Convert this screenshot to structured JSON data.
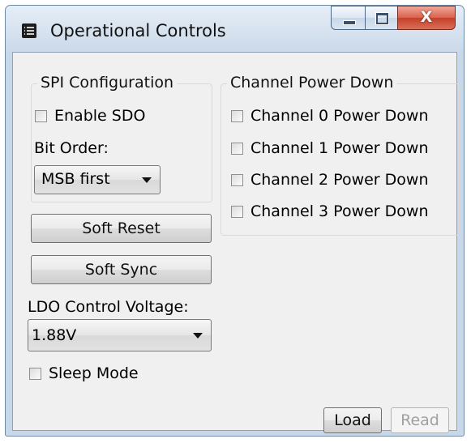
{
  "window": {
    "title": "Operational Controls",
    "controls": {
      "minimize": "minimize",
      "maximize": "maximize",
      "close": "X"
    }
  },
  "spi": {
    "group_title": "SPI Configuration",
    "enable_sdo_label": "Enable SDO",
    "enable_sdo_checked": false,
    "bit_order_label": "Bit Order:",
    "bit_order_value": "MSB first"
  },
  "buttons": {
    "soft_reset": "Soft Reset",
    "soft_sync": "Soft Sync",
    "load": "Load",
    "read": "Read"
  },
  "ldo": {
    "label": "LDO Control Voltage:",
    "value": "1.88V"
  },
  "sleep_mode": {
    "label": "Sleep Mode",
    "checked": false
  },
  "channel_power_down": {
    "group_title": "Channel Power Down",
    "channels": [
      {
        "label": "Channel 0 Power Down",
        "checked": false
      },
      {
        "label": "Channel 1 Power Down",
        "checked": false
      },
      {
        "label": "Channel 2 Power Down",
        "checked": false
      },
      {
        "label": "Channel 3 Power Down",
        "checked": false
      }
    ]
  }
}
